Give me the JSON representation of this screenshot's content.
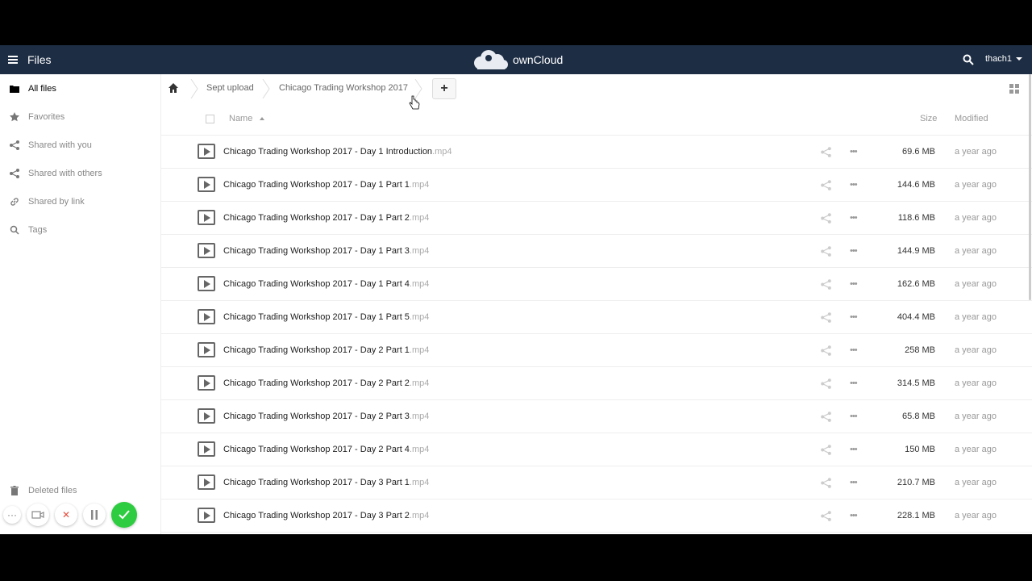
{
  "header": {
    "app_title": "Files",
    "logo_text": "ownCloud",
    "user": "thach1",
    "colors": {
      "bar": "#1d2d44",
      "accent_ok": "#2ecc40"
    }
  },
  "sidebar": {
    "items": [
      {
        "label": "All files",
        "icon": "folder-icon",
        "active": true
      },
      {
        "label": "Favorites",
        "icon": "star-icon"
      },
      {
        "label": "Shared with you",
        "icon": "share-icon"
      },
      {
        "label": "Shared with others",
        "icon": "share-icon"
      },
      {
        "label": "Shared by link",
        "icon": "link-icon"
      },
      {
        "label": "Tags",
        "icon": "search-icon"
      }
    ],
    "deleted_label": "Deleted files"
  },
  "breadcrumb": {
    "items": [
      "Sept upload",
      "Chicago Trading Workshop 2017"
    ],
    "add_label": "+"
  },
  "table": {
    "headers": {
      "name": "Name",
      "size": "Size",
      "modified": "Modified"
    },
    "rows": [
      {
        "name": "Chicago Trading Workshop 2017 - Day 1 Introduction",
        "ext": ".mp4",
        "size": "69.6 MB",
        "modified": "a year ago"
      },
      {
        "name": "Chicago Trading Workshop 2017 - Day 1 Part 1",
        "ext": ".mp4",
        "size": "144.6 MB",
        "modified": "a year ago"
      },
      {
        "name": "Chicago Trading Workshop 2017 - Day 1 Part 2",
        "ext": ".mp4",
        "size": "118.6 MB",
        "modified": "a year ago"
      },
      {
        "name": "Chicago Trading Workshop 2017 - Day 1 Part 3",
        "ext": ".mp4",
        "size": "144.9 MB",
        "modified": "a year ago"
      },
      {
        "name": "Chicago Trading Workshop 2017 - Day 1 Part 4",
        "ext": ".mp4",
        "size": "162.6 MB",
        "modified": "a year ago"
      },
      {
        "name": "Chicago Trading Workshop 2017 - Day 1 Part 5",
        "ext": ".mp4",
        "size": "404.4 MB",
        "modified": "a year ago"
      },
      {
        "name": "Chicago Trading Workshop 2017 - Day 2 Part 1",
        "ext": ".mp4",
        "size": "258 MB",
        "modified": "a year ago"
      },
      {
        "name": "Chicago Trading Workshop 2017 - Day 2 Part 2",
        "ext": ".mp4",
        "size": "314.5 MB",
        "modified": "a year ago"
      },
      {
        "name": "Chicago Trading Workshop 2017 - Day 2 Part 3",
        "ext": ".mp4",
        "size": "65.8 MB",
        "modified": "a year ago"
      },
      {
        "name": "Chicago Trading Workshop 2017 - Day 2 Part 4",
        "ext": ".mp4",
        "size": "150 MB",
        "modified": "a year ago"
      },
      {
        "name": "Chicago Trading Workshop 2017 - Day 3 Part 1",
        "ext": ".mp4",
        "size": "210.7 MB",
        "modified": "a year ago"
      },
      {
        "name": "Chicago Trading Workshop 2017 - Day 3 Part 2",
        "ext": ".mp4",
        "size": "228.1 MB",
        "modified": "a year ago"
      }
    ]
  }
}
